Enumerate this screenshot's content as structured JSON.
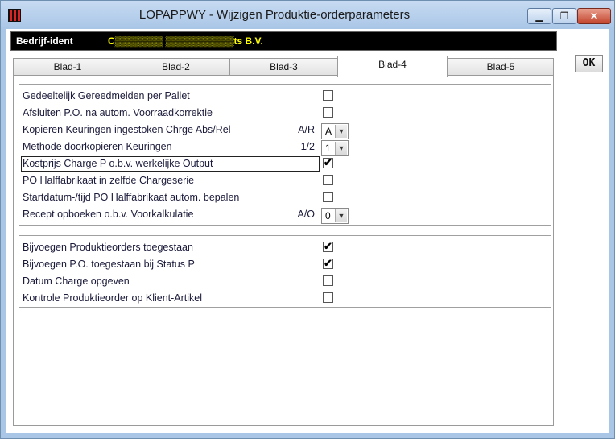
{
  "window": {
    "title": "LOPAPPWY - Wijzigen Produktie-orderparameters"
  },
  "ident": {
    "label": "Bedrijf-ident",
    "value": "C▒▒▒▒▒▒▒ ▒▒▒▒▒▒▒▒▒▒ts B.V."
  },
  "tabs": [
    {
      "label": "Blad-1"
    },
    {
      "label": "Blad-2"
    },
    {
      "label": "Blad-3"
    },
    {
      "label": "Blad-4",
      "active": true
    },
    {
      "label": "Blad-5"
    }
  ],
  "ok_label": "OK",
  "group1": [
    {
      "label": "Gedeeltelijk Gereedmelden per Pallet",
      "checked": false
    },
    {
      "label": "Afsluiten P.O. na autom. Voorraadkorrektie",
      "checked": false
    },
    {
      "label": "Kopieren Keuringen ingestoken Chrge Abs/Rel",
      "code": "A/R",
      "value": "A"
    },
    {
      "label": "Methode doorkopieren Keuringen",
      "code": "1/2",
      "value": "1"
    },
    {
      "label": "Kostprijs Charge P o.b.v. werkelijke Output",
      "checked": true
    },
    {
      "label": "PO Halffabrikaat in zelfde Chargeserie",
      "checked": false
    },
    {
      "label": "Startdatum-/tijd PO Halffabrikaat autom. bepalen",
      "checked": false
    },
    {
      "label": "Recept opboeken o.b.v. Voorkalkulatie",
      "code": "A/O",
      "value": "0"
    }
  ],
  "group2": [
    {
      "label": "Bijvoegen Produktieorders toegestaan",
      "checked": true
    },
    {
      "label": "Bijvoegen P.O. toegestaan bij Status P",
      "checked": true
    },
    {
      "label": "Datum Charge opgeven",
      "checked": false
    },
    {
      "label": "Kontrole Produktieorder op Klient-Artikel",
      "checked": false
    }
  ],
  "glyphs": {
    "check": "✔",
    "dropdown": "▼",
    "minimize": "▁",
    "maximize": "❐",
    "close": "✕"
  }
}
